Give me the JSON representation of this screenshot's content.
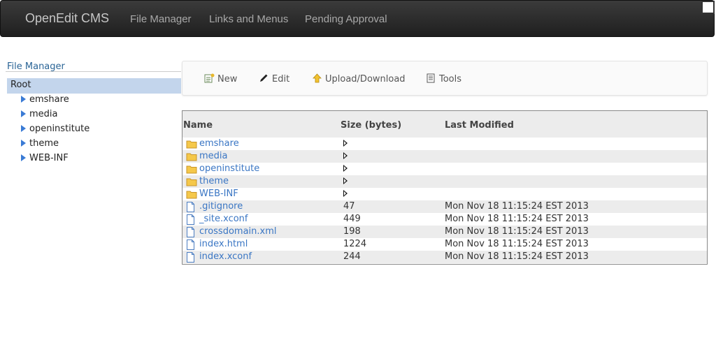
{
  "navbar": {
    "brand": "OpenEdit CMS",
    "links": [
      "File Manager",
      "Links and Menus",
      "Pending Approval"
    ]
  },
  "tree": {
    "title": "File Manager",
    "root": "Root",
    "items": [
      "emshare",
      "media",
      "openinstitute",
      "theme",
      "WEB-INF"
    ]
  },
  "toolbar": {
    "new_label": "New",
    "edit_label": "Edit",
    "upload_label": "Upload/Download",
    "tools_label": "Tools"
  },
  "table": {
    "headers": {
      "name": "Name",
      "size": "Size (bytes)",
      "modified": "Last Modified"
    },
    "rows": [
      {
        "name": "emshare",
        "type": "folder",
        "size": "",
        "modified": ""
      },
      {
        "name": "media",
        "type": "folder",
        "size": "",
        "modified": ""
      },
      {
        "name": "openinstitute",
        "type": "folder",
        "size": "",
        "modified": ""
      },
      {
        "name": "theme",
        "type": "folder",
        "size": "",
        "modified": ""
      },
      {
        "name": "WEB-INF",
        "type": "folder",
        "size": "",
        "modified": ""
      },
      {
        "name": ".gitignore",
        "type": "file",
        "size": "47",
        "modified": "Mon Nov 18 11:15:24 EST 2013"
      },
      {
        "name": "_site.xconf",
        "type": "file",
        "size": "449",
        "modified": "Mon Nov 18 11:15:24 EST 2013"
      },
      {
        "name": "crossdomain.xml",
        "type": "file",
        "size": "198",
        "modified": "Mon Nov 18 11:15:24 EST 2013"
      },
      {
        "name": "index.html",
        "type": "file",
        "size": "1224",
        "modified": "Mon Nov 18 11:15:24 EST 2013"
      },
      {
        "name": "index.xconf",
        "type": "file",
        "size": "244",
        "modified": "Mon Nov 18 11:15:24 EST 2013"
      }
    ]
  },
  "colors": {
    "navbar_bg": "#2a2a2a",
    "link_blue": "#3a76c4",
    "tree_selected": "#c3d5ec",
    "folder_yellow": "#f5c84a"
  }
}
